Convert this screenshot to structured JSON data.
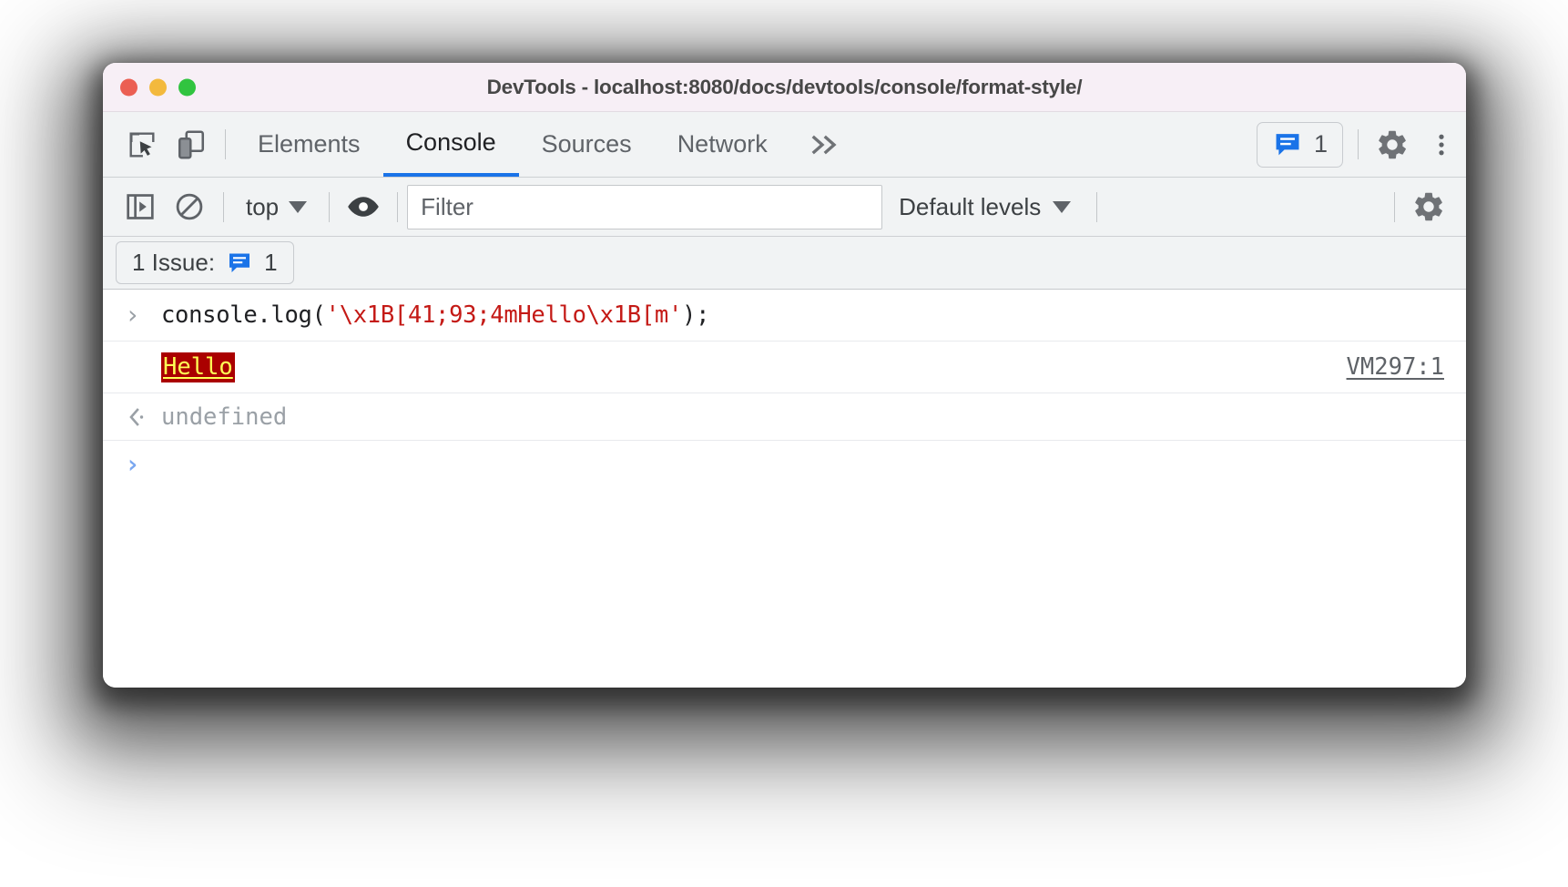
{
  "window": {
    "title": "DevTools - localhost:8080/docs/devtools/console/format-style/",
    "traffic_lights": {
      "close_label": "close",
      "minimize_label": "minimize",
      "maximize_label": "maximize",
      "close_color": "#eb5f53",
      "minimize_color": "#f3b93d",
      "maximize_color": "#31c440"
    }
  },
  "tabstrip": {
    "inspect_icon": "inspect-element-icon",
    "device_toolbar_icon": "device-toolbar-icon",
    "tabs": [
      {
        "label": "Elements",
        "active": false
      },
      {
        "label": "Console",
        "active": true
      },
      {
        "label": "Sources",
        "active": false
      },
      {
        "label": "Network",
        "active": false
      }
    ],
    "more_tabs_label": "»",
    "issues_badge": {
      "icon": "issues-message-icon",
      "count": "1",
      "color": "#1a73e8"
    },
    "settings_icon": "gear-icon",
    "more_options_icon": "kebab-menu-icon"
  },
  "console_toolbar": {
    "sidebar_toggle_icon": "console-sidebar-icon",
    "clear_console_icon": "clear-console-icon",
    "context": {
      "label": "top",
      "caret": "▼"
    },
    "live_expression_icon": "eye-icon",
    "filter": {
      "value": "",
      "placeholder": "Filter"
    },
    "levels": {
      "label": "Default levels",
      "caret": "▼"
    },
    "settings_icon": "console-settings-gear-icon"
  },
  "issues_bar": {
    "label": "1 Issue:",
    "icon": "issues-message-icon",
    "count": "1",
    "icon_color": "#1a73e8"
  },
  "console": {
    "rows": [
      {
        "type": "input",
        "chevron": "›",
        "code_prefix": "console.log(",
        "code_string": "'\\x1B[41;93;4mHello\\x1B[m'",
        "code_suffix": ");"
      },
      {
        "type": "output",
        "text": "Hello",
        "background": "#aa0000",
        "foreground": "#ffff55",
        "underline": true,
        "source": "VM297:1"
      },
      {
        "type": "result",
        "chevron": "‹",
        "text": "undefined"
      },
      {
        "type": "prompt",
        "chevron": "›"
      }
    ]
  }
}
